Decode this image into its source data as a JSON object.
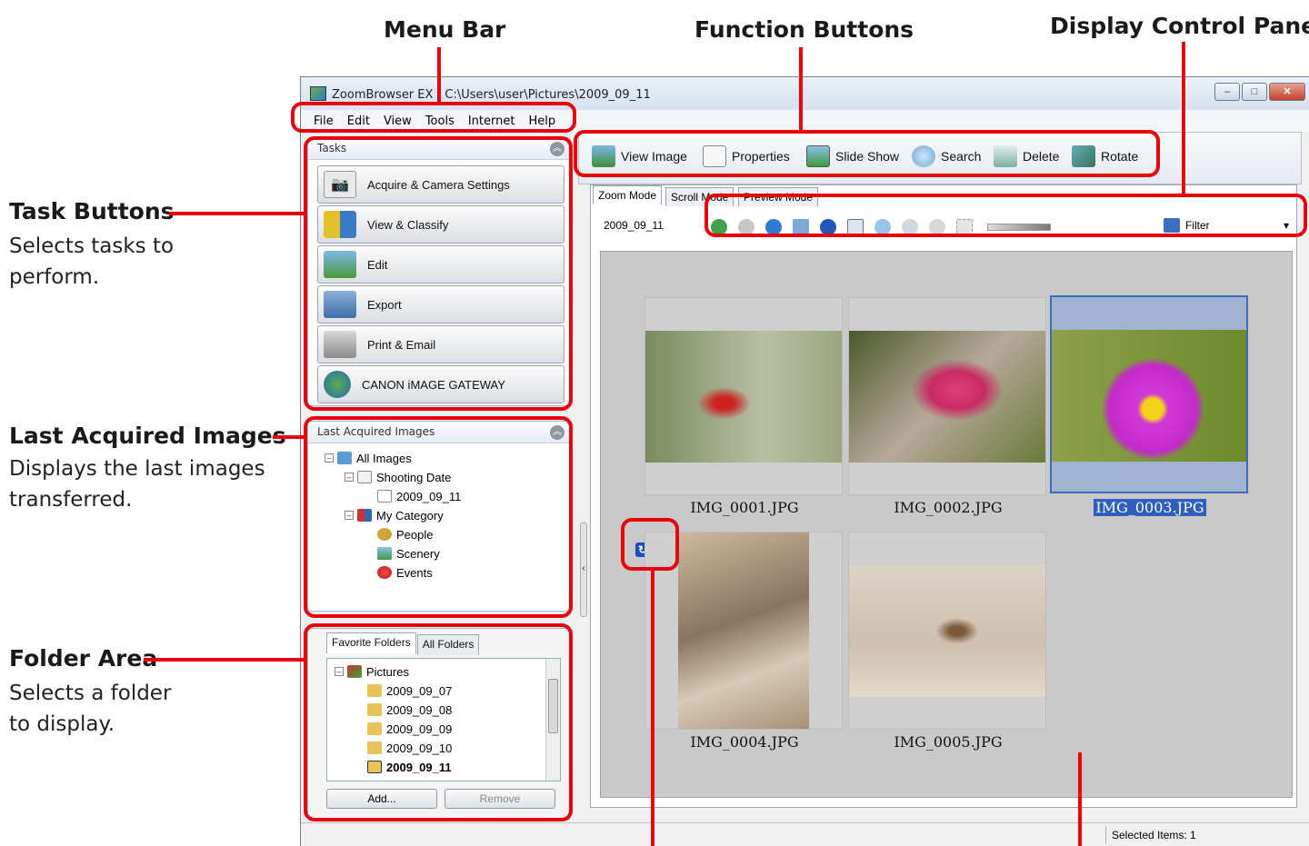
{
  "annotations": {
    "menu_bar": "Menu Bar",
    "function_buttons": "Function Buttons",
    "display_control_panel": "Display Control Panel",
    "task_buttons_title": "Task Buttons",
    "task_buttons_desc_1": "Selects tasks to",
    "task_buttons_desc_2": "perform.",
    "last_acquired_title": "Last Acquired Images",
    "last_acquired_desc_1": "Displays the last images",
    "last_acquired_desc_2": "transferred.",
    "folder_area_title": "Folder Area",
    "folder_area_desc_1": "Selects a folder",
    "folder_area_desc_2": "to display."
  },
  "window": {
    "title": "ZoomBrowser EX - C:\\Users\\user\\Pictures\\2009_09_11",
    "minimize": "–",
    "maximize": "□",
    "close": "✕"
  },
  "menu": [
    "File",
    "Edit",
    "View",
    "Tools",
    "Internet",
    "Help"
  ],
  "tasks": {
    "header": "Tasks",
    "buttons": [
      "Acquire & Camera Settings",
      "View & Classify",
      "Edit",
      "Export",
      "Print & Email",
      "CANON iMAGE GATEWAY"
    ]
  },
  "last_acquired": {
    "header": "Last Acquired Images",
    "tree": [
      "All Images",
      "Shooting Date",
      "2009_09_11",
      "My Category",
      "People",
      "Scenery",
      "Events"
    ]
  },
  "folders": {
    "tabs": [
      "Favorite Folders",
      "All Folders"
    ],
    "tree": [
      "Pictures",
      "2009_09_07",
      "2009_09_08",
      "2009_09_09",
      "2009_09_10",
      "2009_09_11"
    ],
    "add": "Add...",
    "remove": "Remove"
  },
  "function_buttons": [
    "View Image",
    "Properties",
    "Slide Show",
    "Search",
    "Delete",
    "Rotate"
  ],
  "modes": [
    "Zoom Mode",
    "Scroll Mode",
    "Preview Mode"
  ],
  "current_folder": "2009_09_11",
  "filter_label": "Filter",
  "thumbnails": [
    "IMG_0001.JPG",
    "IMG_0002.JPG",
    "IMG_0003.JPG",
    "IMG_0004.JPG",
    "IMG_0005.JPG"
  ],
  "status": "Selected Items: 1",
  "colors": {
    "annotation_red": "#e8000d",
    "selection_blue": "#2f5fbe"
  }
}
